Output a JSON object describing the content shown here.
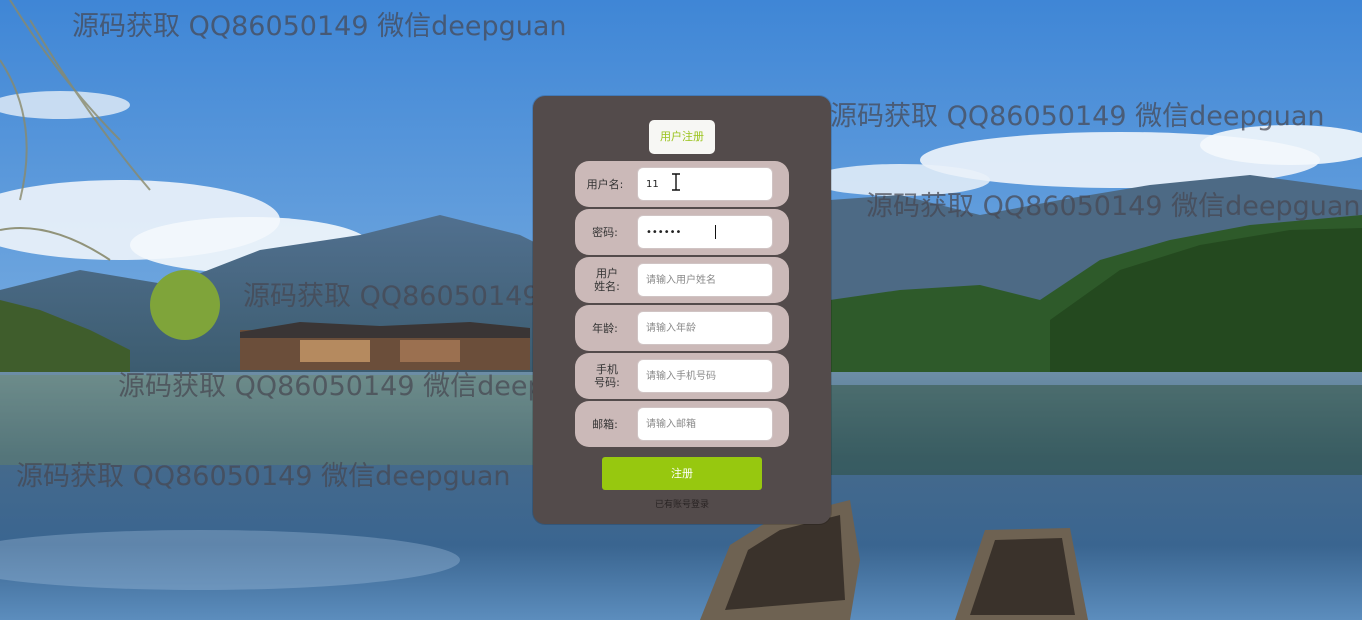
{
  "form": {
    "title": "用户注册",
    "fields": [
      {
        "label": "用户名:",
        "value": "11",
        "placeholder": ""
      },
      {
        "label": "密码:",
        "value": "••••••",
        "placeholder": ""
      },
      {
        "label": "用户姓名:",
        "value": "",
        "placeholder": "请输入用户姓名"
      },
      {
        "label": "年龄:",
        "value": "",
        "placeholder": "请输入年龄"
      },
      {
        "label": "手机号码:",
        "value": "",
        "placeholder": "请输入手机号码"
      },
      {
        "label": "邮箱:",
        "value": "",
        "placeholder": "请输入邮箱"
      }
    ],
    "submit_label": "注册",
    "login_link": "已有账号登录"
  },
  "watermarks": [
    "源码获取 QQ86050149 微信deepguan",
    "源码获取 QQ86050149 微信deepguan",
    "源码获取 QQ86050149 微信deepguan",
    "源码获取 QQ86050149 微信deepguan",
    "源码获取 QQ86050149 微信deepguan",
    "源码获取 QQ86050149 微信deepguan"
  ],
  "colors": {
    "card_bg": "#534b4b",
    "row_bg": "#cbb9b8",
    "accent": "#97c80f",
    "title_text": "#9ac31c"
  }
}
